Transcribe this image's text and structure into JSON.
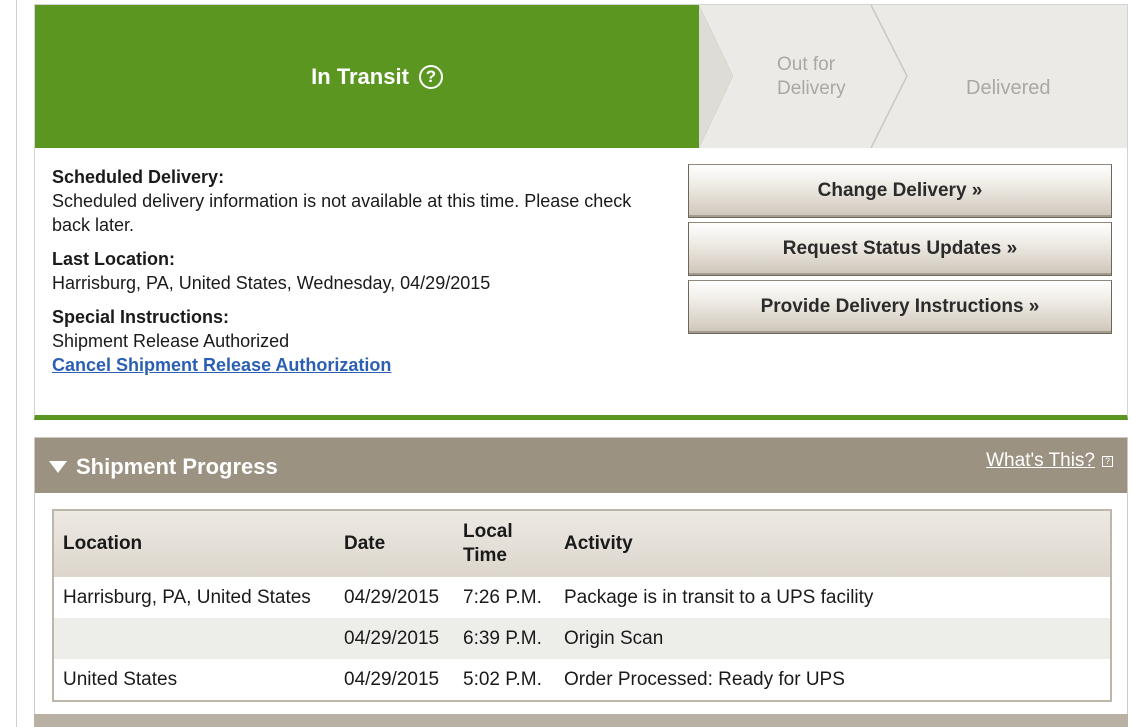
{
  "status": {
    "steps": {
      "current": "In Transit",
      "current_help": "?",
      "out_for_delivery_line1": "Out for",
      "out_for_delivery_line2": "Delivery",
      "delivered": "Delivered"
    },
    "colors": {
      "current_step": "#5a9620",
      "pending_step": "#ebeae7"
    },
    "scheduled_delivery_label": "Scheduled Delivery:",
    "scheduled_delivery_text": "Scheduled delivery information is not available at this time. Please check back later.",
    "last_location_label": "Last Location:",
    "last_location_text": "Harrisburg, PA, United States, Wednesday, 04/29/2015",
    "special_instructions_label": "Special Instructions:",
    "special_instructions_text": "Shipment Release Authorized",
    "cancel_link": "Cancel Shipment Release Authorization",
    "actions": {
      "change_delivery": "Change Delivery »",
      "request_status": "Request Status Updates »",
      "provide_instructions": "Provide Delivery Instructions »"
    }
  },
  "progress": {
    "title": "Shipment Progress",
    "whats_this": "What's This?",
    "whats_this_icon": "?",
    "columns": {
      "location": "Location",
      "date": "Date",
      "time_line1": "Local",
      "time_line2": "Time",
      "activity": "Activity"
    },
    "rows": [
      {
        "location": "Harrisburg, PA, United States",
        "date": "04/29/2015",
        "time": "7:26 P.M.",
        "activity": "Package is in transit to a UPS facility"
      },
      {
        "location": "",
        "date": "04/29/2015",
        "time": "6:39 P.M.",
        "activity": "Origin Scan"
      },
      {
        "location": "United States",
        "date": "04/29/2015",
        "time": "5:02 P.M.",
        "activity": "Order Processed: Ready for UPS"
      }
    ]
  }
}
